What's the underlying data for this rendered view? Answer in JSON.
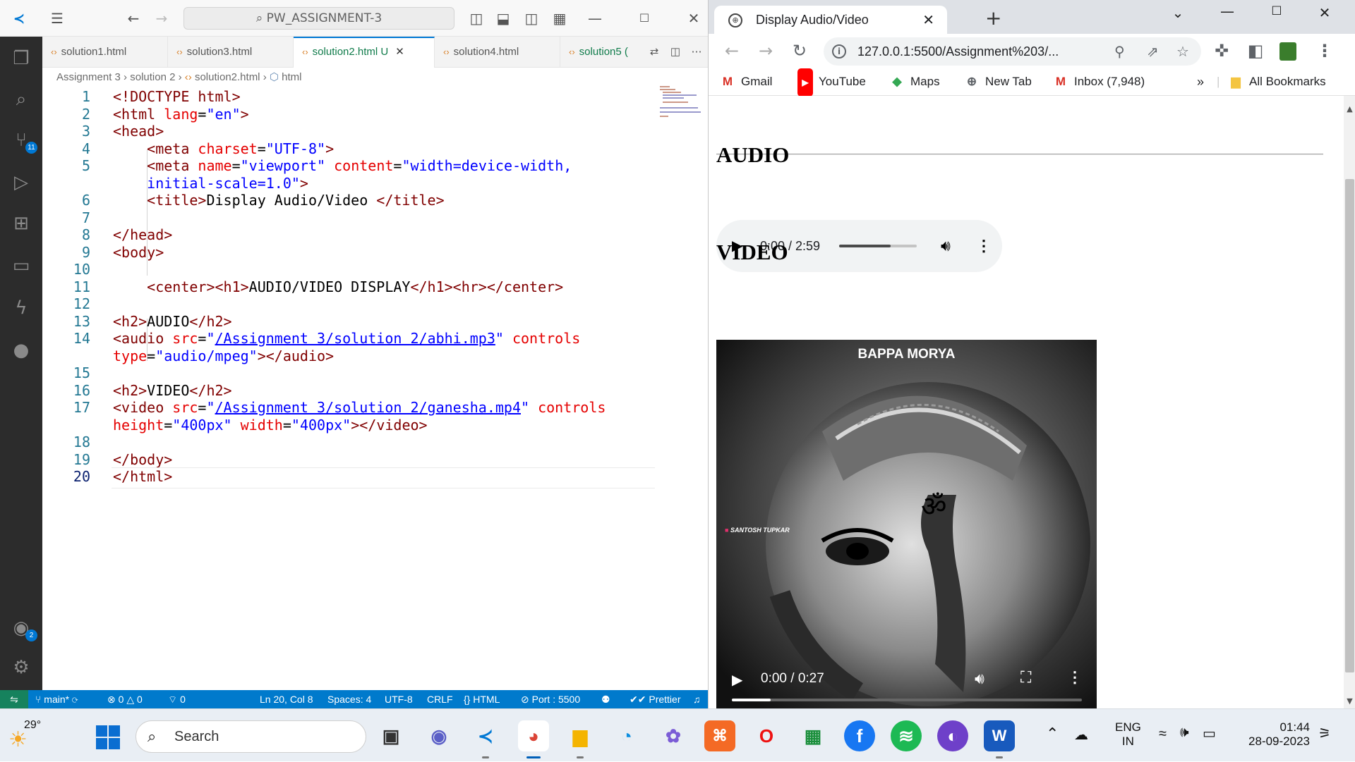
{
  "vscode": {
    "search_text": "PW_ASSIGNMENT-3",
    "tabs": [
      {
        "label": "solution1.html"
      },
      {
        "label": "solution3.html"
      },
      {
        "label": "solution2.html",
        "status": "U"
      },
      {
        "label": "solution4.html"
      },
      {
        "label": "solution5 ("
      }
    ],
    "breadcrumb": [
      "Assignment 3",
      "solution 2",
      "solution2.html",
      "html"
    ],
    "badges": {
      "source_control": "11",
      "accounts": "2"
    },
    "status_bar": {
      "branch": "main*",
      "problems": "0",
      "warnings": "0",
      "ports": "0",
      "cursor": "Ln 20, Col 8",
      "spaces": "Spaces: 4",
      "encoding": "UTF-8",
      "eol": "CRLF",
      "language": "HTML",
      "port": "Port : 5500",
      "formatter": "Prettier"
    }
  },
  "code_lines": [
    {
      "n": "1",
      "segs": [
        [
          "tag",
          "<!DOCTYPE html>"
        ]
      ]
    },
    {
      "n": "2",
      "segs": [
        [
          "tag",
          "<html "
        ],
        [
          "attr",
          "lang"
        ],
        [
          "txt",
          "="
        ],
        [
          "str",
          "\"en\""
        ],
        [
          "tag",
          ">"
        ]
      ]
    },
    {
      "n": "3",
      "segs": [
        [
          "tag",
          "<head>"
        ]
      ]
    },
    {
      "n": "4",
      "segs": [
        [
          "txt",
          "    "
        ],
        [
          "tag",
          "<meta "
        ],
        [
          "attr",
          "charset"
        ],
        [
          "txt",
          "="
        ],
        [
          "str",
          "\"UTF-8\""
        ],
        [
          "tag",
          ">"
        ]
      ]
    },
    {
      "n": "5",
      "segs": [
        [
          "txt",
          "    "
        ],
        [
          "tag",
          "<meta "
        ],
        [
          "attr",
          "name"
        ],
        [
          "txt",
          "="
        ],
        [
          "str",
          "\"viewport\""
        ],
        [
          "txt",
          " "
        ],
        [
          "attr",
          "content"
        ],
        [
          "txt",
          "="
        ],
        [
          "str",
          "\"width=device-width,"
        ]
      ]
    },
    {
      "n": "",
      "segs": [
        [
          "txt",
          "    "
        ],
        [
          "str",
          "initial-scale=1.0\""
        ],
        [
          "tag",
          ">"
        ]
      ]
    },
    {
      "n": "6",
      "segs": [
        [
          "txt",
          "    "
        ],
        [
          "tag",
          "<title>"
        ],
        [
          "txt",
          "Display Audio/Video "
        ],
        [
          "tag",
          "</title>"
        ]
      ]
    },
    {
      "n": "7",
      "segs": []
    },
    {
      "n": "8",
      "segs": [
        [
          "tag",
          "</head>"
        ]
      ]
    },
    {
      "n": "9",
      "segs": [
        [
          "tag",
          "<body>"
        ]
      ]
    },
    {
      "n": "10",
      "segs": []
    },
    {
      "n": "11",
      "segs": [
        [
          "txt",
          "    "
        ],
        [
          "tag",
          "<center><h1>"
        ],
        [
          "txt",
          "AUDIO/VIDEO DISPLAY"
        ],
        [
          "tag",
          "</h1><hr></center>"
        ]
      ]
    },
    {
      "n": "12",
      "segs": []
    },
    {
      "n": "13",
      "segs": [
        [
          "tag",
          "<h2>"
        ],
        [
          "txt",
          "AUDIO"
        ],
        [
          "tag",
          "</h2>"
        ]
      ]
    },
    {
      "n": "14",
      "segs": [
        [
          "tag",
          "<audio "
        ],
        [
          "attr",
          "src"
        ],
        [
          "txt",
          "="
        ],
        [
          "str",
          "\""
        ],
        [
          "lnk",
          "/Assignment 3/solution 2/abhi.mp3"
        ],
        [
          "str",
          "\""
        ],
        [
          "txt",
          " "
        ],
        [
          "attr",
          "controls"
        ]
      ]
    },
    {
      "n": "",
      "segs": [
        [
          "attr",
          "type"
        ],
        [
          "txt",
          "="
        ],
        [
          "str",
          "\"audio/mpeg\""
        ],
        [
          "tag",
          "></audio>"
        ]
      ]
    },
    {
      "n": "15",
      "segs": []
    },
    {
      "n": "16",
      "segs": [
        [
          "tag",
          "<h2>"
        ],
        [
          "txt",
          "VIDEO"
        ],
        [
          "tag",
          "</h2>"
        ]
      ]
    },
    {
      "n": "17",
      "segs": [
        [
          "tag",
          "<video "
        ],
        [
          "attr",
          "src"
        ],
        [
          "txt",
          "="
        ],
        [
          "str",
          "\""
        ],
        [
          "lnk",
          "/Assignment 3/solution 2/ganesha.mp4"
        ],
        [
          "str",
          "\""
        ],
        [
          "txt",
          " "
        ],
        [
          "attr",
          "controls"
        ]
      ]
    },
    {
      "n": "",
      "segs": [
        [
          "attr",
          "height"
        ],
        [
          "txt",
          "="
        ],
        [
          "str",
          "\"400px\""
        ],
        [
          "txt",
          " "
        ],
        [
          "attr",
          "width"
        ],
        [
          "txt",
          "="
        ],
        [
          "str",
          "\"400px\""
        ],
        [
          "tag",
          "></video>"
        ]
      ]
    },
    {
      "n": "18",
      "segs": []
    },
    {
      "n": "19",
      "segs": [
        [
          "tag",
          "</body>"
        ]
      ]
    },
    {
      "n": "20",
      "segs": [
        [
          "tag",
          "</html>"
        ]
      ]
    }
  ],
  "chrome": {
    "tab_title": "Display Audio/Video",
    "url": "127.0.0.1:5500/Assignment%203/...",
    "bookmarks": [
      "Gmail",
      "YouTube",
      "Maps",
      "New Tab",
      "Inbox (7,948)"
    ],
    "all_bookmarks": "All Bookmarks",
    "overflow": "»"
  },
  "webpage": {
    "h1": "AUDIO/VIDEO DISPLAY",
    "audio_heading": "AUDIO",
    "audio_time": "0:00 / 2:59",
    "audio_volume_level": 0.66,
    "video_heading": "VIDEO",
    "video_overlay_title": "BAPPA MORYA",
    "video_credit": "SANTOSH TUPKAR",
    "video_time": "0:00 / 0:27",
    "video_progress": 0.11
  },
  "taskbar": {
    "temperature": "29°",
    "search_placeholder": "Search",
    "language_line1": "ENG",
    "language_line2": "IN",
    "time": "01:44",
    "date": "28-09-2023"
  },
  "colors": {
    "vscode_blue": "#007acc",
    "remote_green": "#16825d",
    "tag": "#800000",
    "attribute": "#e50000",
    "string": "#0000ff"
  }
}
